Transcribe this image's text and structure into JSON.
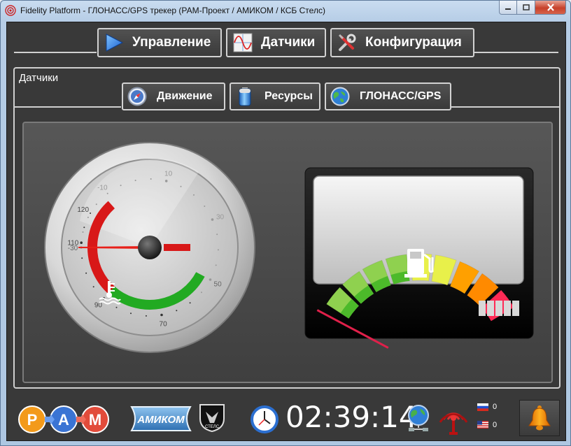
{
  "window": {
    "title": "Fidelity Platform - ГЛОНАСС/GPS трекер (РАМ-Проект / АМИКОМ / КСБ Стелс)"
  },
  "top_tabs": [
    {
      "label": "Управление",
      "icon": "play-icon"
    },
    {
      "label": "Датчики",
      "icon": "sine-chart-icon"
    },
    {
      "label": "Конфигурация",
      "icon": "tools-icon"
    }
  ],
  "sensors": {
    "group_title": "Датчики",
    "tabs": [
      {
        "label": "Движение",
        "icon": "compass-icon"
      },
      {
        "label": "Ресурсы",
        "icon": "battery-icon"
      },
      {
        "label": "ГЛОНАСС/GPS",
        "icon": "globe-icon"
      }
    ]
  },
  "temperature_gauge": {
    "ticks": [
      "-30",
      "-10",
      "10",
      "30",
      "50",
      "70",
      "90",
      "110",
      "120"
    ],
    "min": -30,
    "max": 120,
    "value": -30,
    "icon": "coolant-temperature-icon",
    "colors": {
      "green": "#22aa22",
      "red": "#d81818",
      "needle": "#e8201a"
    }
  },
  "fuel_gauge": {
    "level": 0.0,
    "icon": "fuel-pump-icon",
    "segment_colors": [
      "#8fd14f",
      "#8fd14f",
      "#8fd14f",
      "#8fd14f",
      "#e8f04a",
      "#e8f04a",
      "#ffa000",
      "#ff8a00",
      "#ff2a55"
    ]
  },
  "statusbar": {
    "logos": {
      "ram": [
        "Р",
        "А",
        "М"
      ],
      "amikom": "АМИКОМ",
      "stels": "СТЕЛС"
    },
    "time": "02:39:14",
    "lang_counts": {
      "ru": "0",
      "us": "0"
    },
    "icons": [
      "clock-icon",
      "network-globe-icon",
      "antenna-icon",
      "bell-icon"
    ]
  }
}
